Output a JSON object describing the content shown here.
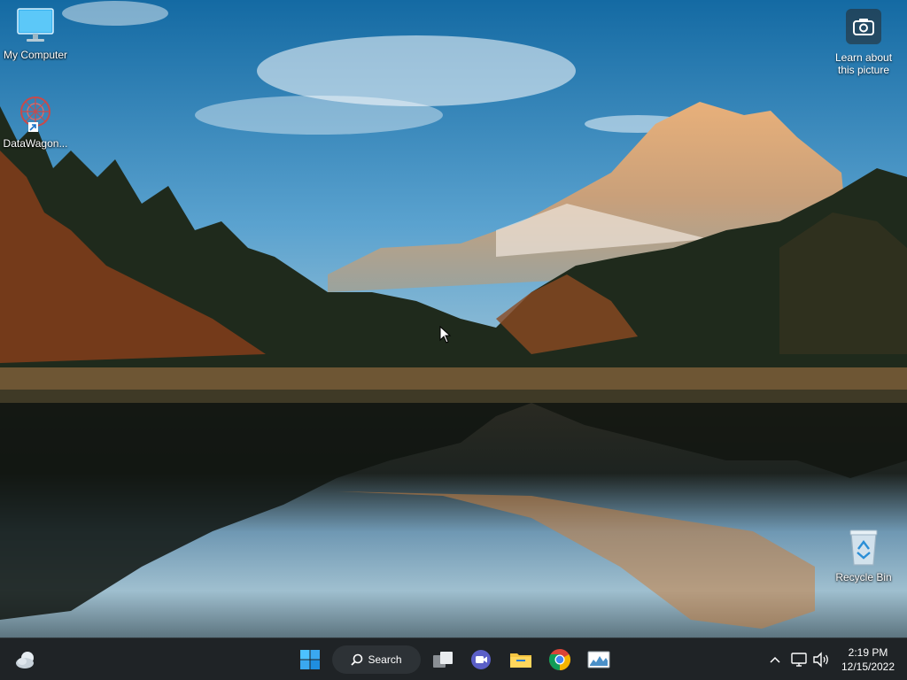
{
  "desktop": {
    "icons": [
      {
        "label": "My Computer",
        "icon": "monitor-icon"
      },
      {
        "label": "DataWagon...",
        "icon": "datawagon-shortcut-icon"
      },
      {
        "label": "Recycle Bin",
        "icon": "recycle-bin-icon"
      }
    ],
    "learn_picture": {
      "label": "Learn about this picture",
      "icon": "camera-icon"
    }
  },
  "taskbar": {
    "search_label": "Search",
    "apps": [
      {
        "name": "start",
        "icon": "windows-logo-icon"
      },
      {
        "name": "task-view",
        "icon": "task-view-icon"
      },
      {
        "name": "teams-chat",
        "icon": "chat-camera-icon"
      },
      {
        "name": "file-explorer",
        "icon": "folder-icon"
      },
      {
        "name": "chrome",
        "icon": "chrome-icon"
      },
      {
        "name": "monitor-app",
        "icon": "chart-window-icon"
      }
    ],
    "tray": [
      "chevron-up-icon",
      "network-icon",
      "volume-icon"
    ],
    "clock": {
      "time": "2:19 PM",
      "date": "12/15/2022"
    },
    "weather_icon": "weather-cloud-icon",
    "accent_color": "#1f2326"
  }
}
